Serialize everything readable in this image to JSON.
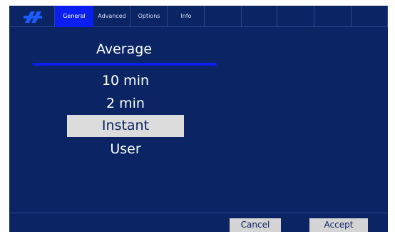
{
  "tabs": [
    {
      "label": "General",
      "active": true
    },
    {
      "label": "Advanced",
      "active": false
    },
    {
      "label": "Options",
      "active": false
    },
    {
      "label": "Info",
      "active": false
    }
  ],
  "menu": {
    "title": "Average",
    "options": [
      {
        "label": "10 min",
        "selected": false
      },
      {
        "label": "2 min",
        "selected": false
      },
      {
        "label": "Instant",
        "selected": true
      },
      {
        "label": "User",
        "selected": false
      }
    ]
  },
  "footer": {
    "cancel_label": "Cancel",
    "accept_label": "Accept"
  },
  "colors": {
    "background": "#0a2464",
    "accent": "#0a1ef0",
    "selection": "#dcdcdc",
    "button": "#d4d4d4"
  },
  "icons": {
    "logo": "brand-logo-icon"
  }
}
